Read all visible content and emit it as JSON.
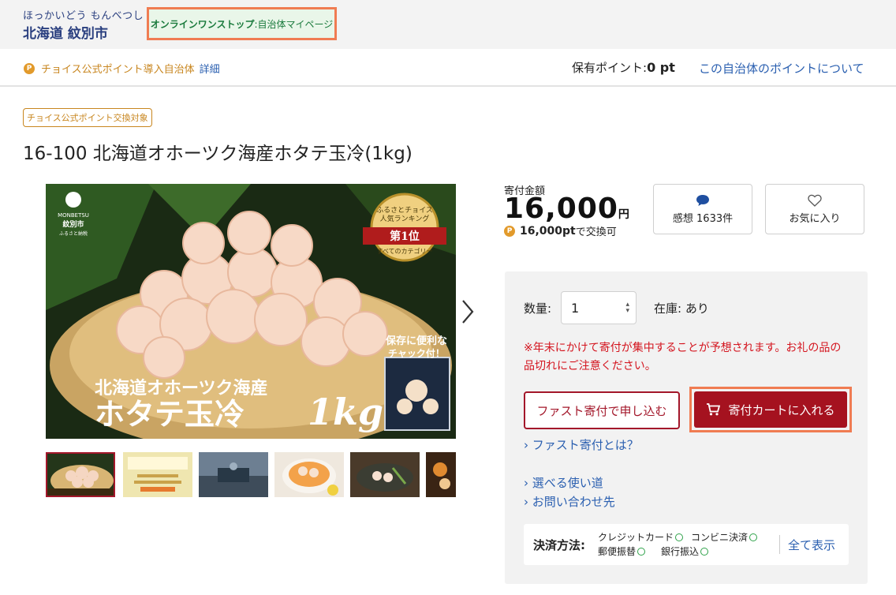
{
  "header": {
    "municipality_kana": "ほっかいどう もんべつし",
    "municipality_name": "北海道 紋別市",
    "onestop_strong": "オンラインワンストップ",
    "onestop_rest": ":自治体マイページ"
  },
  "point_bar": {
    "point_icon": "P",
    "official_text": "チョイス公式ポイント導入自治体",
    "detail_link": "詳細",
    "held_label": "保有ポイント:",
    "held_value": "0 pt",
    "about_link": "この自治体のポイントについて"
  },
  "product": {
    "badge": "チョイス公式ポイント交換対象",
    "title": "16-100 北海道オホーツク海産ホタテ玉冷(1kg)",
    "image_text_top": "北海道オホーツク海産",
    "image_text_main": "ホタテ玉冷",
    "image_text_weight": "1kg",
    "image_rank_line1": "ふるさとチョイス",
    "image_rank_line2": "人気ランキング",
    "image_rank_main": "第1位",
    "image_rank_sub": "すべてのカテゴリー",
    "image_pack_text1": "保存に便利な",
    "image_pack_text2": "チャック付！",
    "image_logo_line1": "MONBETSU",
    "image_logo_line2": "紋別市",
    "image_logo_line3": "ふるさと納税",
    "thumbnails": [
      "scallops-bowl",
      "gold-flyer",
      "fishing-boat",
      "scallop-rice-bowl",
      "sashimi-plate",
      "dish"
    ]
  },
  "donation": {
    "label": "寄付金額",
    "amount": "16,000",
    "currency": "円",
    "points_value": "16,000pt",
    "points_suffix": "で交換可"
  },
  "reviews_button": {
    "label": "感想 1633件",
    "icon": "speech-bubble-icon"
  },
  "favorite_button": {
    "label": "お気に入り",
    "icon": "heart-icon"
  },
  "order_panel": {
    "qty_label": "数量:",
    "qty_value": "1",
    "stock_text": "在庫: あり",
    "notice": "※年末にかけて寄付が集中することが予想されます。お礼の品の品切れにご注意ください。",
    "fast_button": "ファスト寄付で申し込む",
    "cart_button": "寄付カートに入れる",
    "fast_about_link": "› ファスト寄付とは？",
    "usage_link": "› 選べる使い道",
    "contact_link": "› お問い合わせ先"
  },
  "payment": {
    "label": "決済方法:",
    "methods": [
      "クレジットカード",
      "コンビニ決済",
      "郵便振替",
      "銀行振込"
    ],
    "show_all": "全て表示"
  },
  "colors": {
    "brand_red": "#a5121f",
    "highlight_orange": "#f07c52",
    "link_blue": "#2a5fb0",
    "point_gold": "#c8861f",
    "notice_red": "#d4151f"
  }
}
